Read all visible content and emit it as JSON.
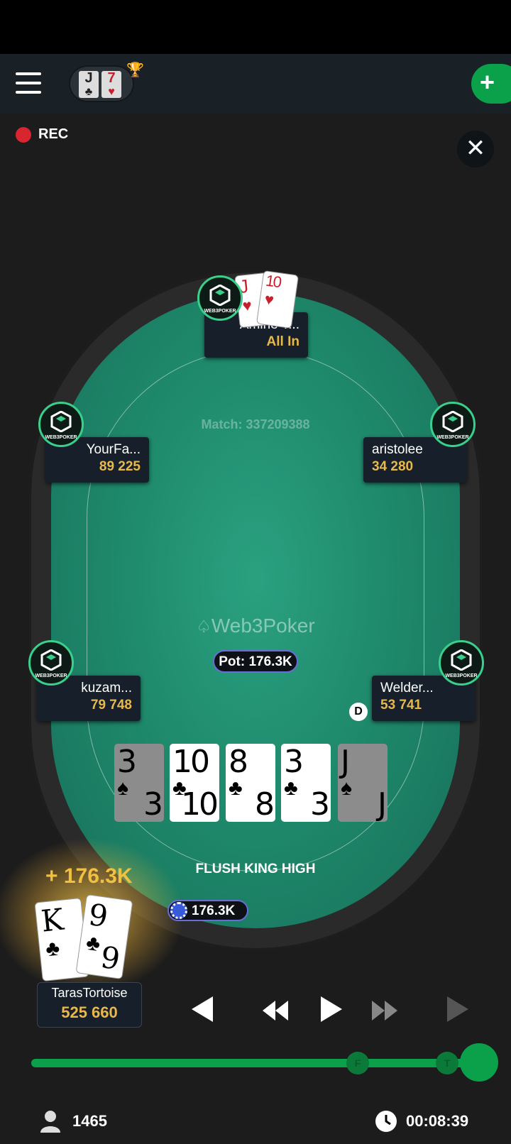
{
  "header": {
    "rec_label": "REC"
  },
  "mini_hand": [
    {
      "rank": "J",
      "suit": "♣",
      "color": "#222222"
    },
    {
      "rank": "7",
      "suit": "♥",
      "color": "#c8202a"
    }
  ],
  "table": {
    "match_label": "Match: 337209388",
    "brand": "Web3Poker",
    "pot_label": "Pot: 176.3K",
    "dealer_label": "D",
    "hand_result": "FLUSH KING HIGH",
    "bet_amount": "176.3K",
    "win_amount": "+ 176.3K"
  },
  "avatar_label": "WEB3POKER",
  "players": {
    "top": {
      "name": "Amine T...",
      "status": "All In",
      "cards": [
        {
          "rank": "J",
          "suit": "♥"
        },
        {
          "rank": "10",
          "suit": "♥"
        }
      ]
    },
    "left_upper": {
      "name": "YourFa...",
      "stack": "89 225"
    },
    "right_upper": {
      "name": "aristolee",
      "stack": "34 280"
    },
    "left_lower": {
      "name": "kuzam...",
      "stack": "79 748"
    },
    "right_lower": {
      "name": "Welder...",
      "stack": "53 741"
    },
    "hero": {
      "name": "TarasTortoise",
      "stack": "525 660",
      "cards": [
        {
          "rank": "K",
          "suit": "♣"
        },
        {
          "rank": "9",
          "suit": "♣"
        }
      ]
    }
  },
  "board": [
    {
      "rank": "3",
      "suit": "♠",
      "dim": true
    },
    {
      "rank": "10",
      "suit": "♣",
      "dim": false
    },
    {
      "rank": "8",
      "suit": "♣",
      "dim": false
    },
    {
      "rank": "3",
      "suit": "♣",
      "dim": false
    },
    {
      "rank": "J",
      "suit": "♠",
      "dim": true
    }
  ],
  "timeline": {
    "markers": [
      "F",
      "T"
    ]
  },
  "footer": {
    "players_count": "1465",
    "elapsed": "00:08:39"
  },
  "colors": {
    "accent": "#0aa14a",
    "stack": "#e8b84a",
    "felt": "#1f8a6c",
    "rec": "#d9252f"
  }
}
